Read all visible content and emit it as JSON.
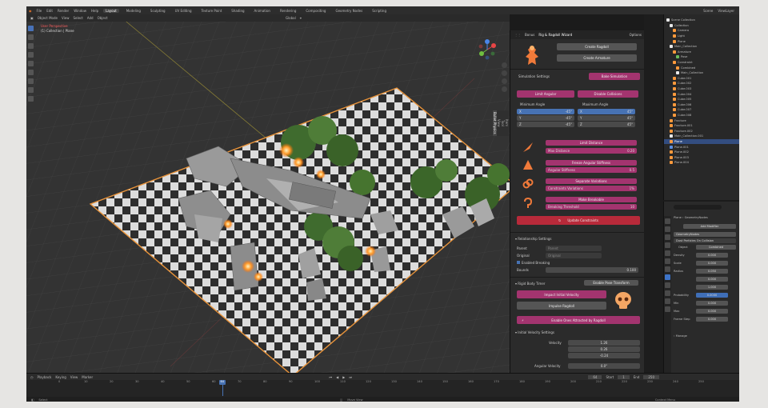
{
  "topbar": {
    "menus": [
      "File",
      "Edit",
      "Render",
      "Window",
      "Help"
    ],
    "workspaces": [
      "Layout",
      "Modeling",
      "Sculpting",
      "UV Editing",
      "Texture Paint",
      "Shading",
      "Animation",
      "Rendering",
      "Compositing",
      "Geometry Nodes",
      "Scripting"
    ],
    "active_workspace": "Layout",
    "scene": "Scene",
    "view_layer": "ViewLayer"
  },
  "viewport": {
    "mode": "Object Mode",
    "menus": [
      "View",
      "Select",
      "Add",
      "Object"
    ],
    "orientation": "Global",
    "info_line1": "User Perspective",
    "info_line2": "(1) Collection | Plane",
    "ntabs": [
      "Item",
      "Tool",
      "View",
      "Bullet Physics"
    ]
  },
  "addon": {
    "header_tabs": [
      "Bonus",
      "Rig & Ragdoll Wizard"
    ],
    "header_right": "Options",
    "create_ragdoll": "Create Ragdoll",
    "create_armature": "Create Armature",
    "simulation_settings": "Simulation Settings",
    "bake_simulation": "Bake Simulation",
    "limit_angular": "Limit Angular",
    "disable_collisions": "Disable Collisions",
    "min_angle": "Minimum Angle",
    "max_angle": "Maximum Angle",
    "min_vals": [
      {
        "axis": "X",
        "val": "-45°"
      },
      {
        "axis": "Y",
        "val": "-45°"
      },
      {
        "axis": "Z",
        "val": "-45°"
      }
    ],
    "max_vals": [
      {
        "axis": "X",
        "val": "45°"
      },
      {
        "axis": "Y",
        "val": "45°"
      },
      {
        "axis": "Z",
        "val": "45°"
      }
    ],
    "limit_distance": "Limit Distance",
    "max_distance": "Max Distance",
    "max_distance_val": "0.20",
    "freeze_angular": "Freeze Angular Stiffness",
    "angular_stiffness": "Angular Stiffness",
    "angular_stiffness_val": "0.5",
    "separate_variations": "Separate Variations",
    "constraints_variations": "Constraints Variations",
    "constraints_variations_val": "1%",
    "make_breakable": "Make Breakable",
    "breaking_threshold": "Breaking Threshold",
    "breaking_threshold_val": "10",
    "update_constraints": "Update Constraints",
    "relationship_settings": "Relationship Settings",
    "parent_label": "Parent",
    "parent_val": "Parent",
    "original_label": "Original",
    "original_val": "Original",
    "enabled_breaking": "Enabled Breaking",
    "bounds_label": "Bounds",
    "bounds_val": "0.100",
    "rigid_body_timer": "Rigid Body Timer",
    "enable_pose_transform": "Enable Pose Transform",
    "impact_velocity": "Impact Initial Velocity",
    "impulse_ragdoll": "Impulse Ragdoll",
    "enable_impulse": "Enable Ones Attracted by Ragdoll",
    "velocity_settings": "Initial Velocity Settings",
    "velocity_label": "Velocity",
    "velocity_vals": [
      "1.26",
      "0.26",
      "-0.24"
    ],
    "angular_velocity_label": "Angular Velocity",
    "angular_velocity_val": "0.0°"
  },
  "outliner": {
    "rows": [
      {
        "label": "Scene Collection",
        "type": "col",
        "indent": 0
      },
      {
        "label": "Collection",
        "type": "col",
        "indent": 1
      },
      {
        "label": "Camera",
        "type": "obj",
        "indent": 2
      },
      {
        "label": "Light",
        "type": "obj",
        "indent": 2
      },
      {
        "label": "Plane",
        "type": "obj",
        "indent": 2
      },
      {
        "label": "Main_Collection",
        "type": "col",
        "indent": 1
      },
      {
        "label": "Armature",
        "type": "obj",
        "indent": 2
      },
      {
        "label": "Pose",
        "type": "green",
        "indent": 3
      },
      {
        "label": "Constraint",
        "type": "obj",
        "indent": 2
      },
      {
        "label": "Combined",
        "type": "obj",
        "indent": 3
      },
      {
        "label": "Main_Collection",
        "type": "col",
        "indent": 3
      },
      {
        "label": "Cube.001",
        "type": "obj",
        "indent": 2
      },
      {
        "label": "Cube.002",
        "type": "obj",
        "indent": 2
      },
      {
        "label": "Cube.003",
        "type": "obj",
        "indent": 2
      },
      {
        "label": "Cube.004",
        "type": "obj",
        "indent": 2
      },
      {
        "label": "Cube.005",
        "type": "obj",
        "indent": 2
      },
      {
        "label": "Cube.006",
        "type": "obj",
        "indent": 2
      },
      {
        "label": "Cube.007",
        "type": "obj",
        "indent": 2
      },
      {
        "label": "Cube.008",
        "type": "obj",
        "indent": 2
      },
      {
        "label": "Fracture",
        "type": "obj",
        "indent": 1
      },
      {
        "label": "Fracture.001",
        "type": "obj",
        "indent": 1
      },
      {
        "label": "Fracture.002",
        "type": "obj",
        "indent": 1
      },
      {
        "label": "Main_Collection.001",
        "type": "col",
        "indent": 1
      },
      {
        "label": "Plane",
        "type": "obj",
        "indent": 1,
        "selected": true
      },
      {
        "label": "Plane.001",
        "type": "blue",
        "indent": 1
      },
      {
        "label": "Plane.002",
        "type": "obj",
        "indent": 1
      },
      {
        "label": "Plane.003",
        "type": "obj",
        "indent": 1
      },
      {
        "label": "Plane.004",
        "type": "obj",
        "indent": 1
      }
    ]
  },
  "props": {
    "object_name": "Plane",
    "modifier_name": "GeometryNodes",
    "add_modifier": "Add Modifier",
    "node_group": "GeometryNodes",
    "panel_title": "Dust Particles On Collision",
    "object_label": "Object",
    "object_val": "Combined",
    "rows": [
      {
        "label": "Density",
        "val": "0.000"
      },
      {
        "label": "Scale",
        "val": "0.000"
      },
      {
        "label": "Radius",
        "val": "0.050"
      },
      {
        "label": "",
        "val": "0.000"
      },
      {
        "label": "",
        "val": "1.000"
      },
      {
        "label": "Probability",
        "val": "0.0000"
      },
      {
        "label": "Min",
        "val": "0.000"
      },
      {
        "label": "Max",
        "val": "0.000"
      },
      {
        "label": "Frame Step",
        "val": "0.000"
      }
    ],
    "manage": "Manage"
  },
  "timeline": {
    "menus": [
      "Playback",
      "Keying",
      "View",
      "Marker"
    ],
    "current_frame": "64",
    "start_label": "Start",
    "start_val": "1",
    "end_label": "End",
    "end_val": "250",
    "ruler": [
      "0",
      "10",
      "20",
      "30",
      "40",
      "50",
      "60",
      "70",
      "80",
      "90",
      "100",
      "110",
      "120",
      "130",
      "140",
      "150",
      "160",
      "170",
      "180",
      "190",
      "200",
      "210",
      "220",
      "230",
      "240",
      "250"
    ],
    "status_left": "Select",
    "status_mid": "Move View",
    "status_right": "Context Menu"
  }
}
